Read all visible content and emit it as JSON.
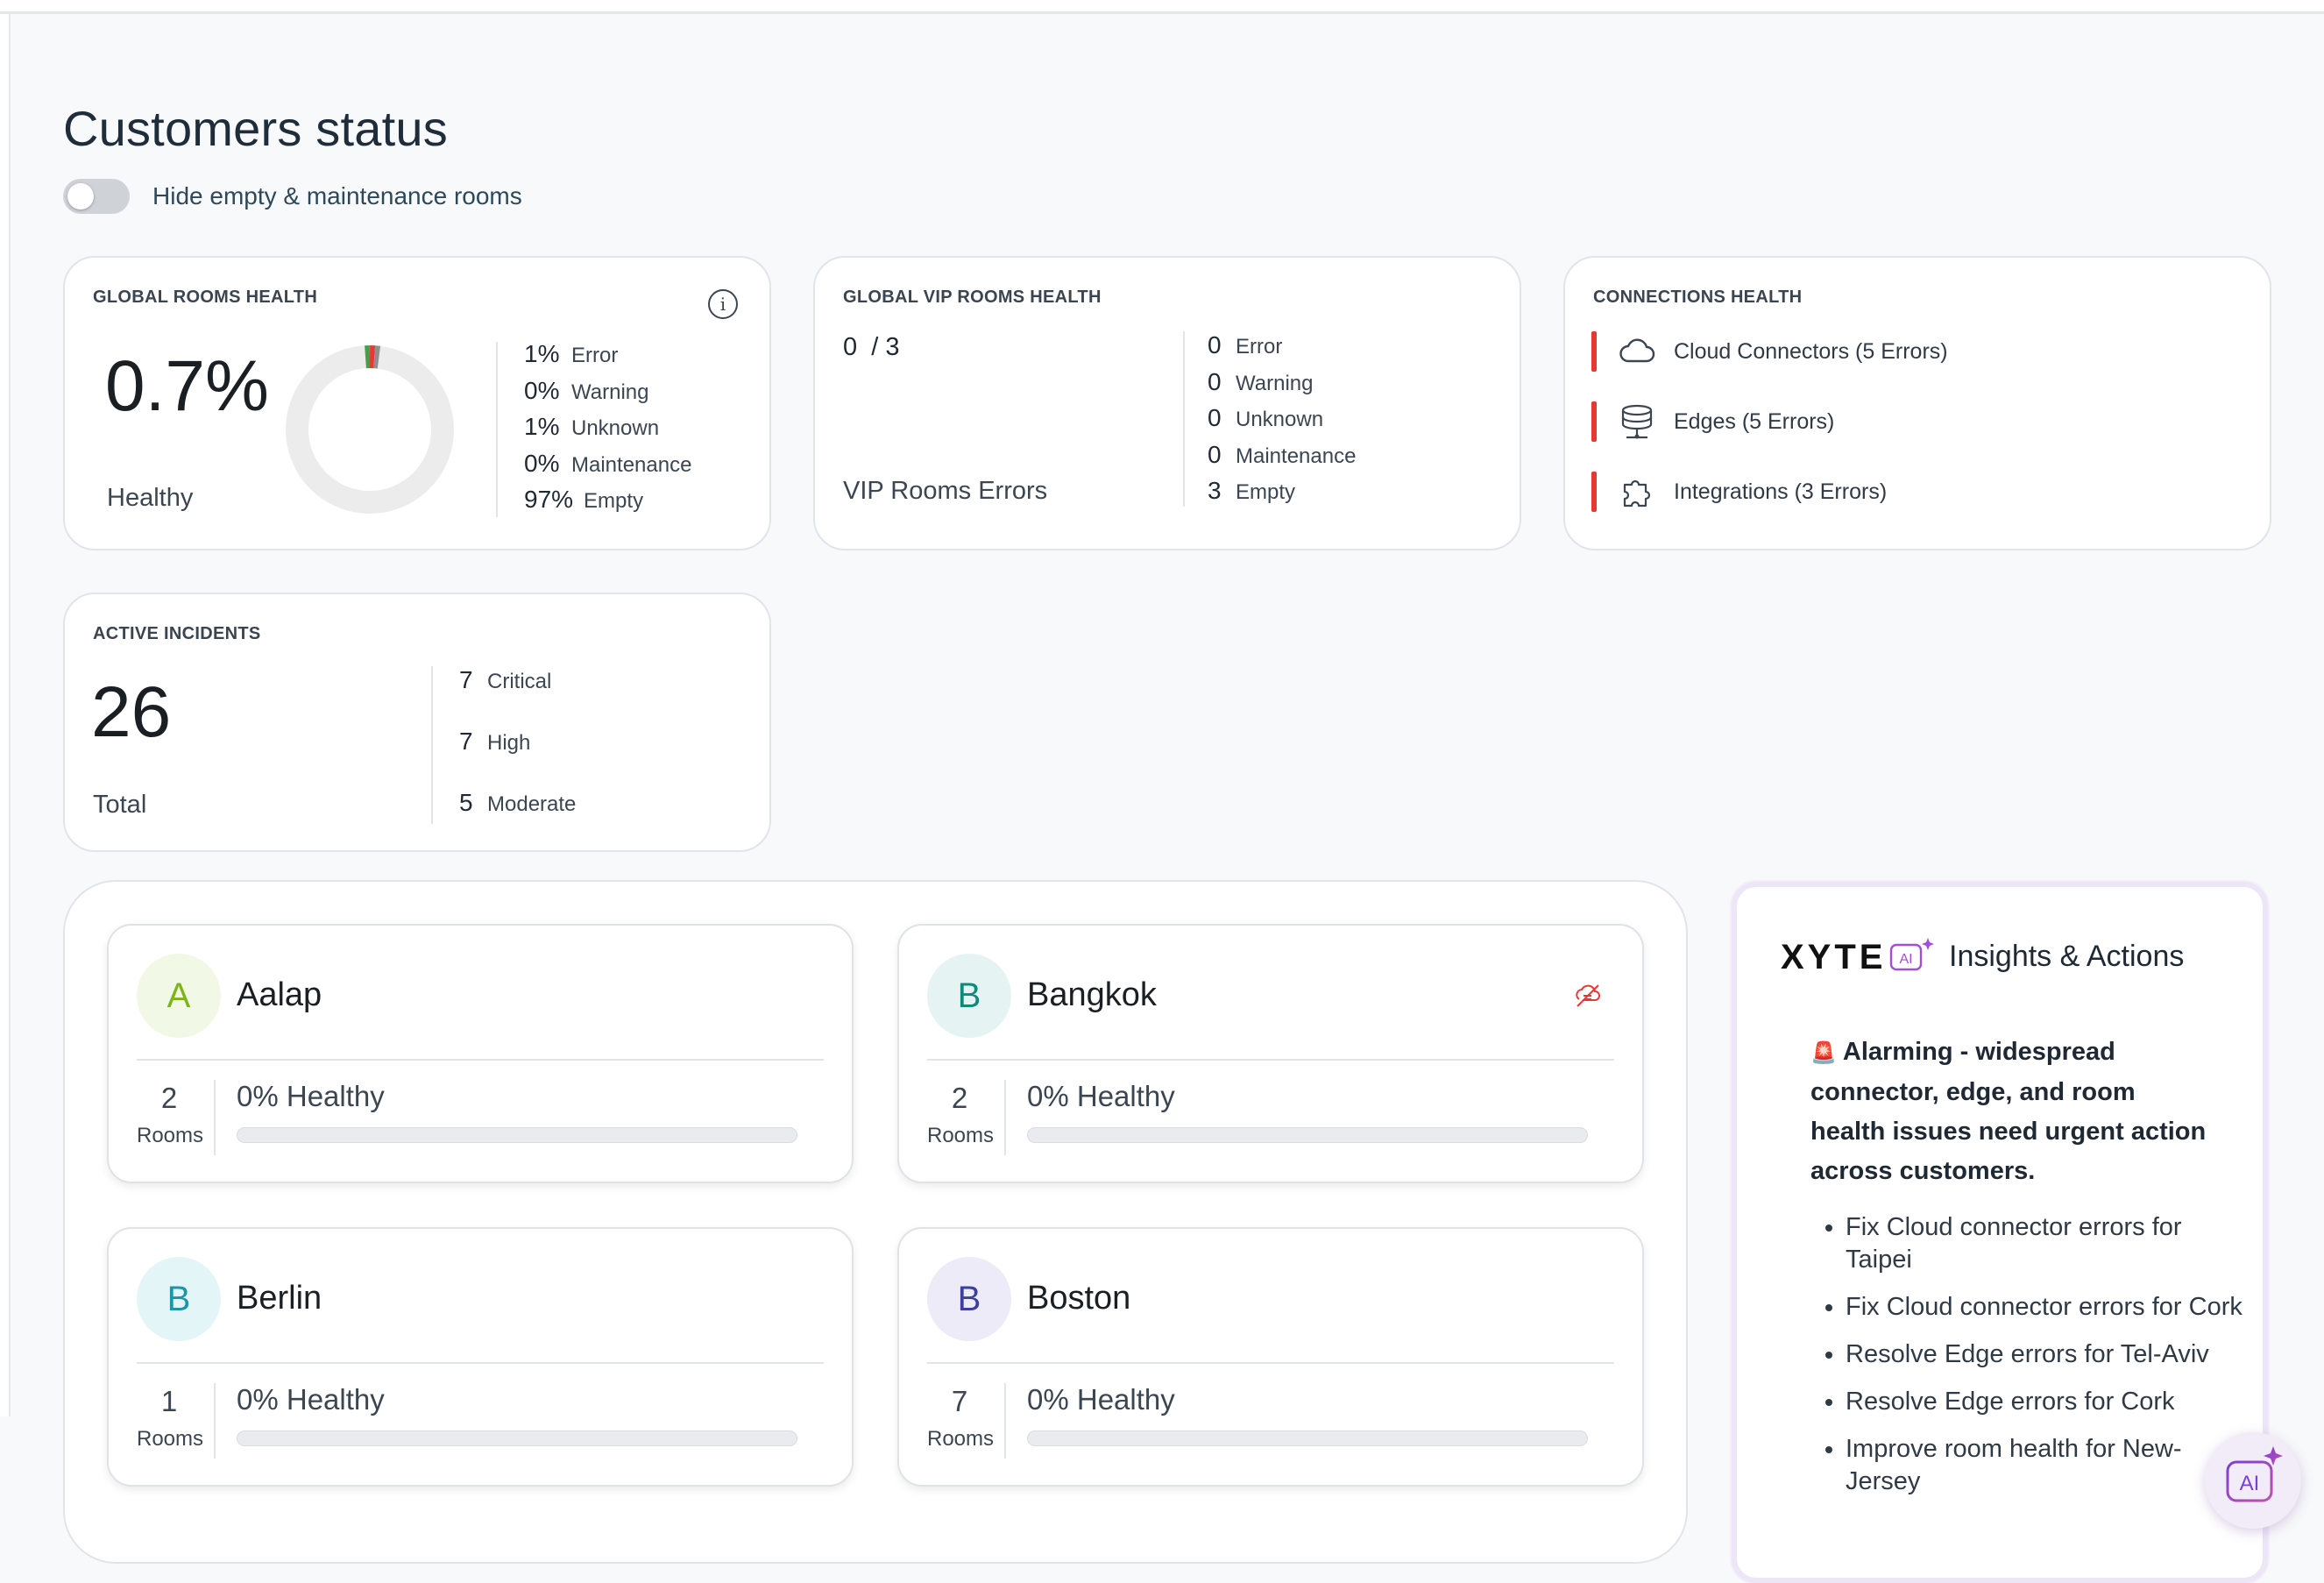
{
  "page": {
    "title": "Customers status",
    "toggle_label": "Hide empty & maintenance rooms",
    "toggle_on": false
  },
  "rooms_health": {
    "title": "GLOBAL ROOMS HEALTH",
    "value": "0.7%",
    "label": "Healthy",
    "stats": [
      {
        "value": "1%",
        "label": "Error"
      },
      {
        "value": "0%",
        "label": "Warning"
      },
      {
        "value": "1%",
        "label": "Unknown"
      },
      {
        "value": "0%",
        "label": "Maintenance"
      },
      {
        "value": "97%",
        "label": "Empty"
      }
    ],
    "donut_colors": {
      "track": "#ececec",
      "error": "#e53935",
      "healthy": "#43a047",
      "unknown": "#9e9e9e"
    }
  },
  "vip_health": {
    "title": "GLOBAL VIP ROOMS HEALTH",
    "ratio": "0  / 3",
    "label": "VIP Rooms Errors",
    "stats": [
      {
        "value": "0",
        "label": "Error"
      },
      {
        "value": "0",
        "label": "Warning"
      },
      {
        "value": "0",
        "label": "Unknown"
      },
      {
        "value": "0",
        "label": "Maintenance"
      },
      {
        "value": "3",
        "label": "Empty"
      }
    ]
  },
  "connections": {
    "title": "CONNECTIONS HEALTH",
    "items": [
      {
        "label": "Cloud Connectors (5 Errors)",
        "icon": "cloud-icon"
      },
      {
        "label": "Edges (5 Errors)",
        "icon": "server-icon"
      },
      {
        "label": "Integrations (3 Errors)",
        "icon": "puzzle-icon"
      }
    ],
    "error_color": "#e53935"
  },
  "incidents": {
    "title": "ACTIVE INCIDENTS",
    "total": "26",
    "total_label": "Total",
    "stats": [
      {
        "value": "7",
        "label": "Critical"
      },
      {
        "value": "7",
        "label": "High"
      },
      {
        "value": "5",
        "label": "Moderate"
      }
    ]
  },
  "customers": [
    {
      "initial": "A",
      "name": "Aalap",
      "rooms": "2",
      "rooms_label": "Rooms",
      "health": "0% Healthy",
      "avatar_bg": "#f1f8e6",
      "avatar_fg": "#7cb518",
      "alert": false
    },
    {
      "initial": "B",
      "name": "Bangkok",
      "rooms": "2",
      "rooms_label": "Rooms",
      "health": "0% Healthy",
      "avatar_bg": "#e5f4f2",
      "avatar_fg": "#0f8a7a",
      "alert": true
    },
    {
      "initial": "B",
      "name": "Berlin",
      "rooms": "1",
      "rooms_label": "Rooms",
      "health": "0% Healthy",
      "avatar_bg": "#e3f5f7",
      "avatar_fg": "#1a96a6",
      "alert": false
    },
    {
      "initial": "B",
      "name": "Boston",
      "rooms": "7",
      "rooms_label": "Rooms",
      "health": "0% Healthy",
      "avatar_bg": "#ecebf7",
      "avatar_fg": "#3c3f9e",
      "alert": false
    }
  ],
  "insights": {
    "brand": "XYTE",
    "brand_badge": "AI",
    "title": "Insights & Actions",
    "alert_icon": "🚨",
    "alert": "Alarming - widespread connector, edge, and room health issues need urgent action across customers.",
    "actions": [
      "Fix Cloud connector errors for Taipei",
      "Fix Cloud connector errors for Cork",
      "Resolve Edge errors for Tel-Aviv",
      "Resolve Edge errors for Cork",
      "Improve room health for New-Jersey"
    ]
  },
  "ai_fab": {
    "label": "AI",
    "icon": "ai-sparkle-icon"
  }
}
